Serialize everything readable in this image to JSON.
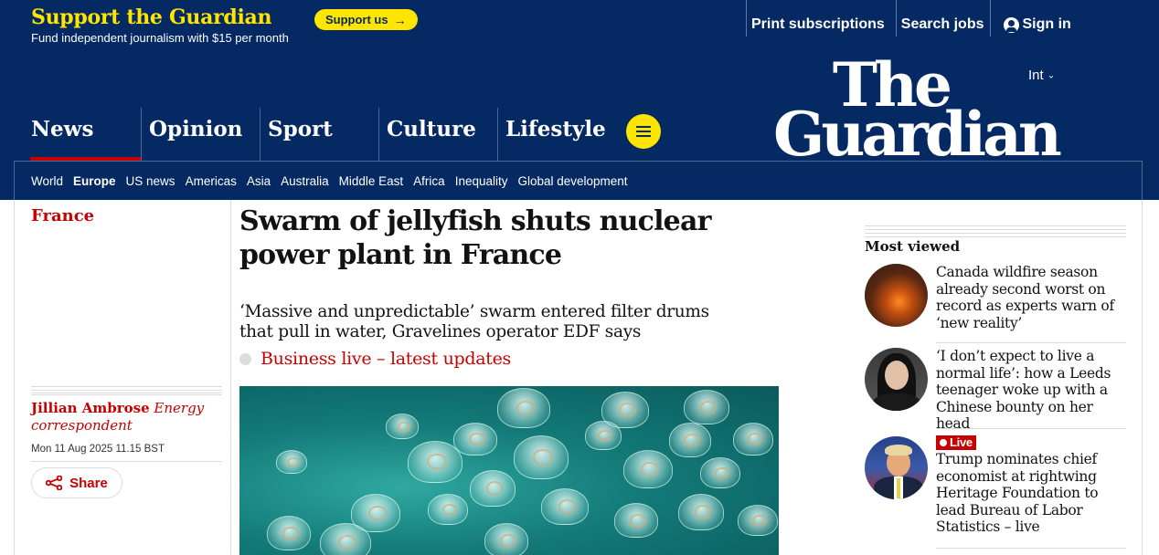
{
  "support": {
    "title": "Support the Guardian",
    "subtitle": "Fund independent journalism with $15 per month",
    "button_label": "Support us",
    "button_arrow": "→"
  },
  "top_links": {
    "print": "Print subscriptions",
    "jobs": "Search jobs",
    "signin": "Sign in"
  },
  "edition": {
    "label": "Int",
    "chevron": "⌄"
  },
  "logo": {
    "line1": "The",
    "line2": "Guardian"
  },
  "pillars": [
    {
      "label": "News"
    },
    {
      "label": "Opinion"
    },
    {
      "label": "Sport"
    },
    {
      "label": "Culture"
    },
    {
      "label": "Lifestyle"
    }
  ],
  "subnav": [
    "World",
    "Europe",
    "US news",
    "Americas",
    "Asia",
    "Australia",
    "Middle East",
    "Africa",
    "Inequality",
    "Global development"
  ],
  "article": {
    "section": "France",
    "headline": "Swarm of jellyfish shuts nuclear power plant in France",
    "standfirst": "‘Massive and unpredictable’ swarm entered filter drums that pull in water, Gravelines operator EDF says",
    "live_link": "Business live – latest updates",
    "author": "Jillian Ambrose",
    "author_role": "Energy correspondent",
    "dateline": "Mon 11 Aug 2025 11.15 BST",
    "share_label": "Share"
  },
  "most_viewed": {
    "title": "Most viewed",
    "items": [
      {
        "headline": "Canada wildfire season already second worst on record as experts warn of ‘new reality’"
      },
      {
        "headline": "‘I don’t expect to live a normal life’: how a Leeds teenager woke up with a Chinese bounty on her head"
      },
      {
        "badge": "Live",
        "headline": "Trump nominates chief economist at rightwing Heritage Foundation to lead Bureau of Labor Statistics – live"
      }
    ]
  },
  "colors": {
    "brand_blue": "#052962",
    "support_yellow": "#ffe500",
    "news_red": "#c70000"
  }
}
